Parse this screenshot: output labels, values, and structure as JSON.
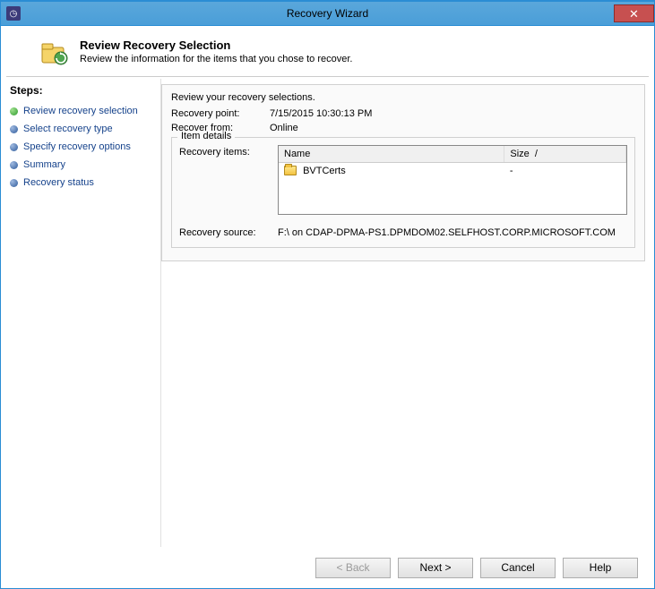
{
  "window": {
    "title": "Recovery Wizard"
  },
  "header": {
    "title": "Review Recovery Selection",
    "subtitle": "Review the information for the items that you chose to recover."
  },
  "steps": {
    "title": "Steps:",
    "items": [
      {
        "label": "Review recovery selection",
        "bullet": "green",
        "current": true
      },
      {
        "label": "Select recovery type",
        "bullet": "blue",
        "current": false
      },
      {
        "label": "Specify recovery options",
        "bullet": "blue",
        "current": false
      },
      {
        "label": "Summary",
        "bullet": "blue",
        "current": false
      },
      {
        "label": "Recovery status",
        "bullet": "blue",
        "current": false
      }
    ]
  },
  "content": {
    "reviewLine": "Review your recovery selections.",
    "recoveryPointLabel": "Recovery point:",
    "recoveryPointValue": "7/15/2015 10:30:13 PM",
    "recoverFromLabel": "Recover from:",
    "recoverFromValue": "Online",
    "itemDetailsLegend": "Item details",
    "recoveryItemsLabel": "Recovery items:",
    "table": {
      "headers": {
        "name": "Name",
        "size": "Size"
      },
      "rows": [
        {
          "name": "BVTCerts",
          "size": "-"
        }
      ]
    },
    "recoverySourceLabel": "Recovery source:",
    "recoverySourceValue": "F:\\ on CDAP-DPMA-PS1.DPMDOM02.SELFHOST.CORP.MICROSOFT.COM"
  },
  "buttons": {
    "back": "< Back",
    "next": "Next >",
    "cancel": "Cancel",
    "help": "Help"
  }
}
